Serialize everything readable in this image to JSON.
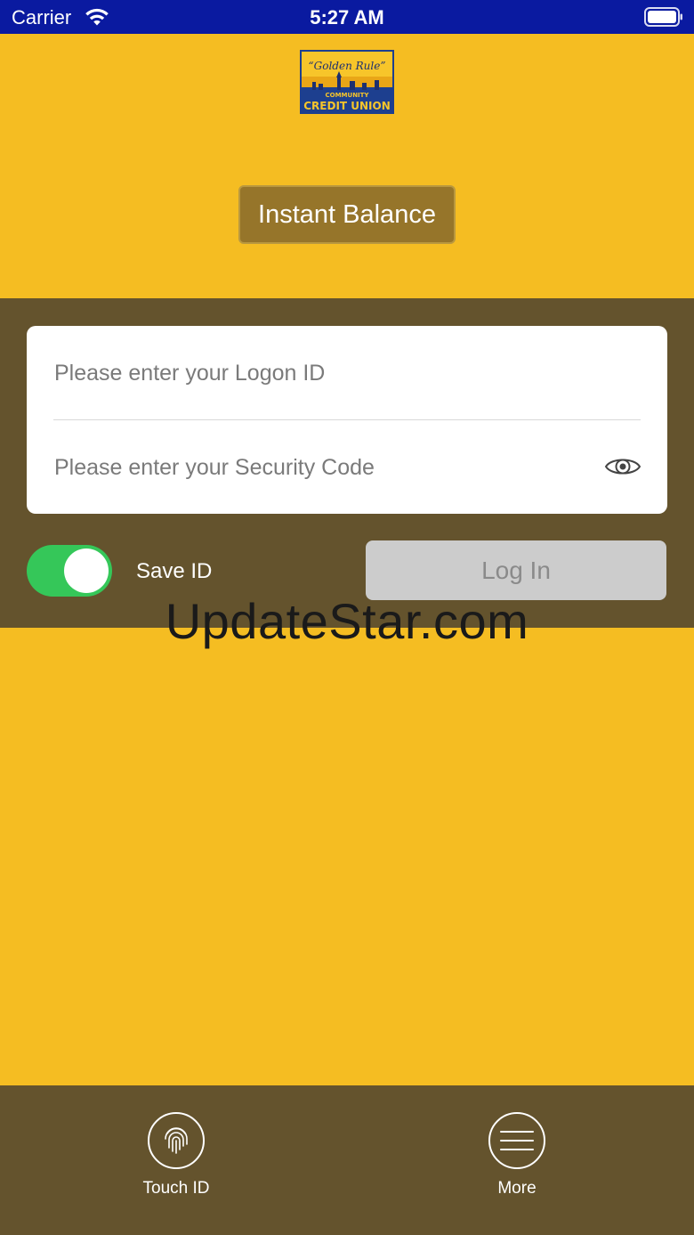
{
  "status_bar": {
    "carrier": "Carrier",
    "time": "5:27 AM",
    "background_color": "#0a1aa0",
    "icons": [
      "wifi-icon",
      "battery-icon"
    ]
  },
  "logo": {
    "name": "Golden Rule Community Credit Union logo",
    "script_text": "Golden Rule",
    "line1": "COMMUNITY",
    "line2": "CREDIT UNION"
  },
  "instant_balance": {
    "label": "Instant Balance"
  },
  "login": {
    "logon_id_placeholder": "Please enter your Logon ID",
    "security_code_placeholder": "Please enter your Security Code",
    "reveal_icon": "eye-icon",
    "save_id_label": "Save ID",
    "save_id_on": true,
    "login_label": "Log In"
  },
  "watermark": {
    "text": "UpdateStar.com"
  },
  "toolbar": {
    "touch_id_label": "Touch ID",
    "touch_id_icon": "fingerprint-icon",
    "more_label": "More",
    "more_icon": "hamburger-menu-icon"
  },
  "colors": {
    "background": "#f5bd22",
    "band": "#64532d",
    "button": "#96752a",
    "toggle_on": "#35c759",
    "login_disabled": "#cccccc"
  }
}
